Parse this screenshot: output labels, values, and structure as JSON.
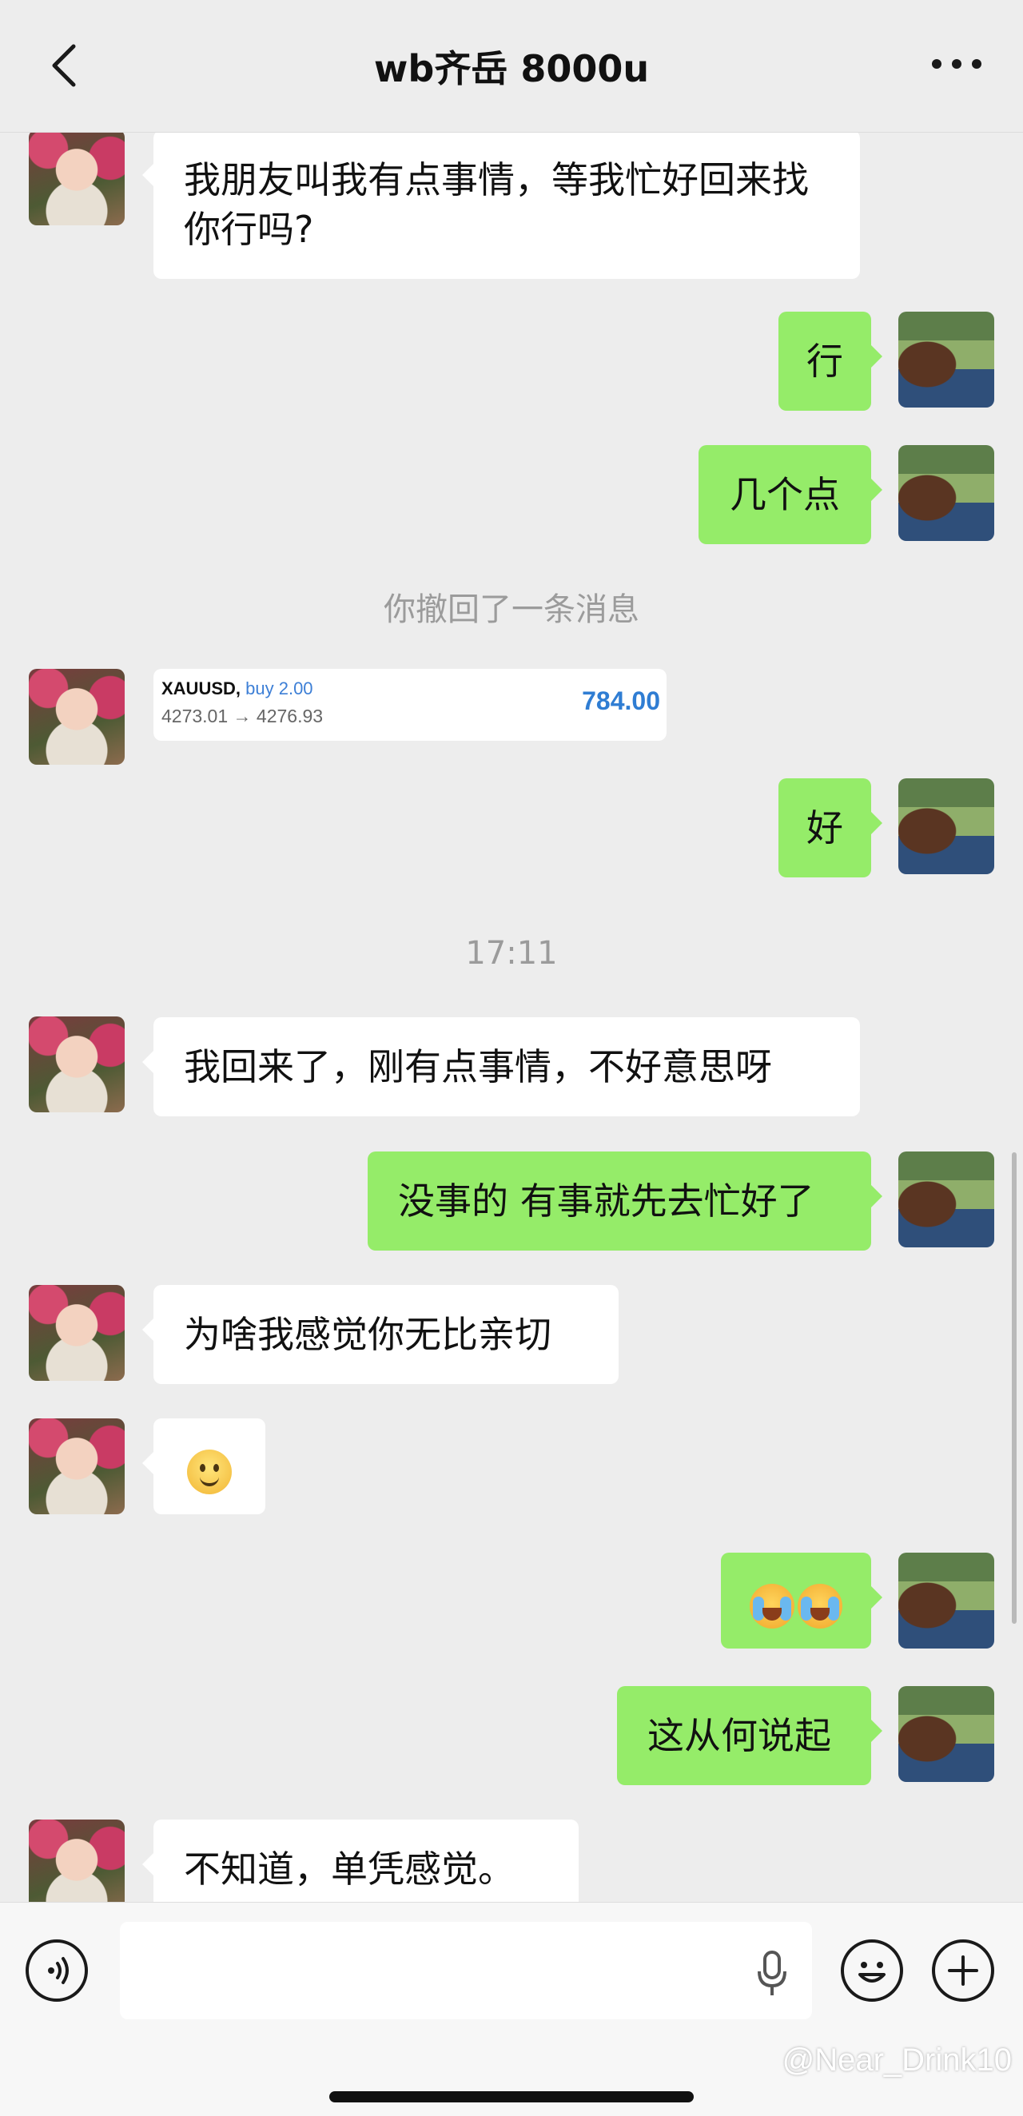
{
  "header": {
    "title": "wb齐岳 8000u",
    "back_icon": "chevron-left-icon",
    "more_icon": "more-dots-icon"
  },
  "messages": [
    {
      "from": "them",
      "text": "我朋友叫我有点事情，等我忙好回来找你行吗?"
    },
    {
      "from": "me",
      "text": "行"
    },
    {
      "from": "me",
      "text": "几个点"
    },
    {
      "type": "system",
      "text": "你撤回了一条消息"
    },
    {
      "from": "them",
      "type": "trade_card",
      "symbol": "XAUUSD,",
      "side": "buy 2.00",
      "prices": "4273.01 → 4276.93",
      "profit": "784.00"
    },
    {
      "from": "me",
      "text": "好"
    },
    {
      "type": "timestamp",
      "text": "17:11"
    },
    {
      "from": "them",
      "text": "我回来了，刚有点事情，不好意思呀"
    },
    {
      "from": "me",
      "text": "没事的 有事就先去忙好了"
    },
    {
      "from": "them",
      "text": "为啥我感觉你无比亲切"
    },
    {
      "from": "them",
      "emoji": "smile-emoji"
    },
    {
      "from": "me",
      "emoji": "laugh-cry-emoji x2"
    },
    {
      "from": "me",
      "text": "这从何说起"
    },
    {
      "from": "them",
      "text": "不知道，单凭感觉。"
    }
  ],
  "input_bar": {
    "voice_icon": "voice-mode-icon",
    "mic_icon": "microphone-icon",
    "emoji_icon": "emoji-icon",
    "plus_icon": "plus-icon"
  },
  "watermark": "@Near_Drink10",
  "colors": {
    "background": "#ededed",
    "outgoing_bubble": "#95ec69",
    "incoming_bubble": "#ffffff",
    "system_text": "#9b9b9b",
    "trade_profit": "#2f7dd3"
  }
}
